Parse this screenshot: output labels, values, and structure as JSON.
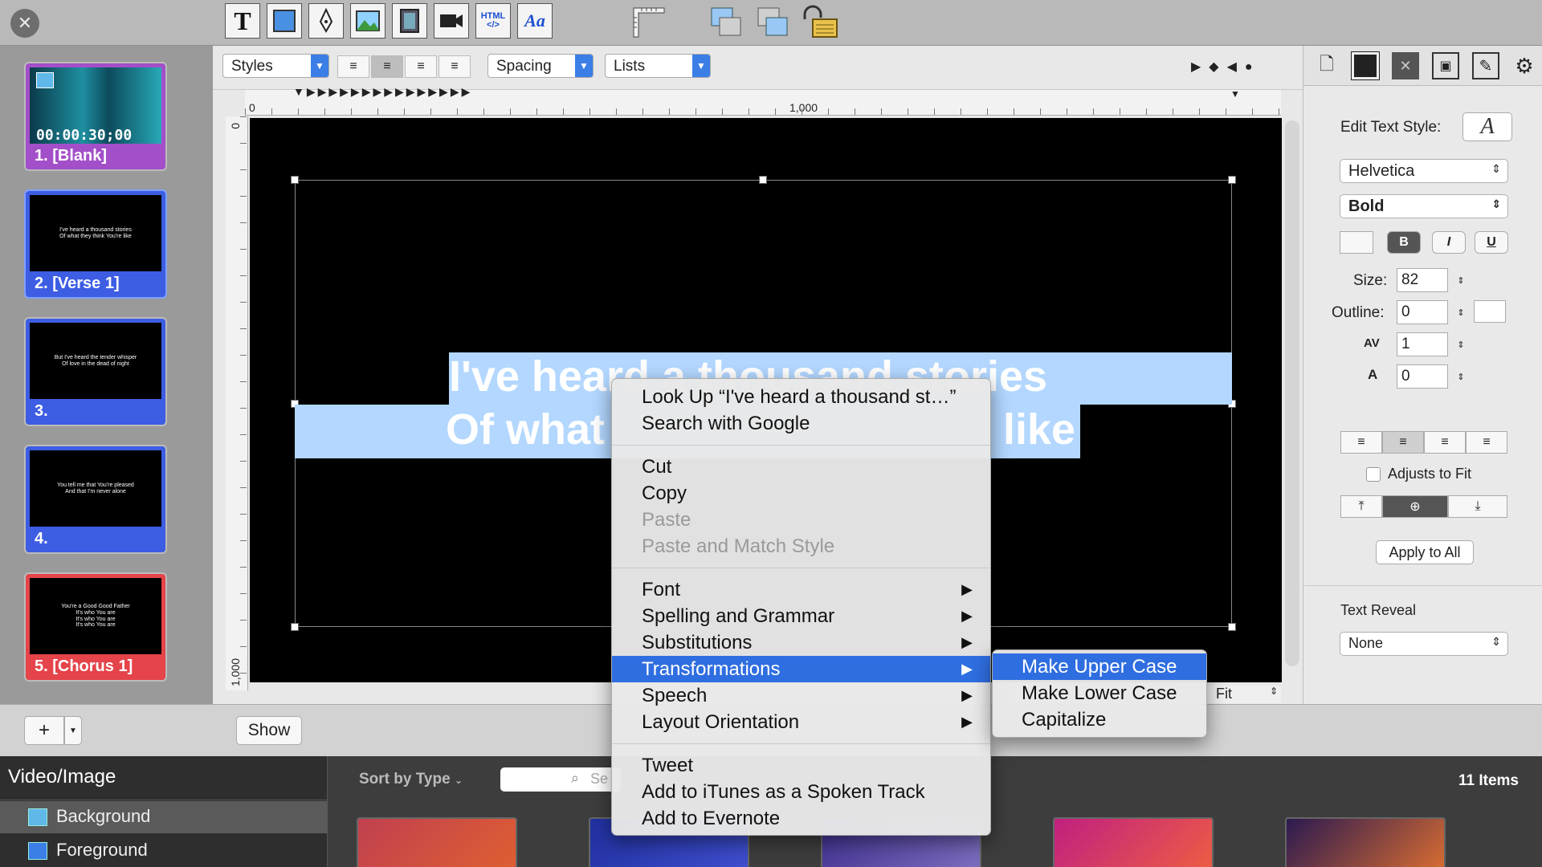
{
  "toolbar": {
    "tools": [
      "text-tool-icon",
      "shape-tool-icon",
      "pen-tool-icon",
      "image-tool-icon",
      "video-tool-icon",
      "camera-tool-icon",
      "html-tool-icon",
      "textstyle-tool-icon"
    ],
    "text_tool_label": "T",
    "html_label": "HTML",
    "textstyle_label": "Aa"
  },
  "slides": [
    {
      "label": "1. [Blank]",
      "timecode": "00:00:30;00",
      "color": "#a34fc9",
      "text": ""
    },
    {
      "label": "2. [Verse 1]",
      "color": "#3d5de3",
      "text": "I've heard a thousand stories\nOf what they think You're like"
    },
    {
      "label": "3.",
      "color": "#3d5de3",
      "text": "But I've heard the tender whisper\nOf love in the dead of night"
    },
    {
      "label": "4.",
      "color": "#3d5de3",
      "text": "You tell me that You're pleased\nAnd that I'm never alone"
    },
    {
      "label": "5. [Chorus 1]",
      "color": "#e4444a",
      "text": "You're a Good Good Father\nIt's who You are\nIt's who You are\nIt's who You are"
    }
  ],
  "editor": {
    "styles_label": "Styles",
    "spacing_label": "Spacing",
    "lists_label": "Lists",
    "ruler_h": [
      "0",
      "1,000"
    ],
    "ruler_v": [
      "0",
      "1,000"
    ],
    "line1": "I've heard a thousand stories",
    "line2": "Of what",
    "line2_end": "like",
    "fit_label": "Fit"
  },
  "inspector": {
    "edit_text_style": "Edit Text Style:",
    "font": "Helvetica",
    "weight": "Bold",
    "size_label": "Size:",
    "size": "82",
    "outline_label": "Outline:",
    "outline": "0",
    "kerning_label": "AV",
    "kerning": "1",
    "leading_label": "A",
    "leading": "0",
    "adjusts_to_fit": "Adjusts to Fit",
    "apply_all": "Apply to All",
    "text_reveal_label": "Text Reveal",
    "text_reveal": "None"
  },
  "bottom": {
    "show_label": "Show",
    "add_label": "+",
    "bin_title": "Video/Image",
    "sort_label": "Sort by Type",
    "search_placeholder": "Se",
    "items_count": "11 Items",
    "categories": [
      "Background",
      "Foreground"
    ]
  },
  "context_menu": {
    "group1": [
      "Look Up “I've heard a thousand st…”",
      "Search with Google"
    ],
    "group2": [
      "Cut",
      "Copy",
      "Paste",
      "Paste and Match Style"
    ],
    "group3": [
      "Font",
      "Spelling and Grammar",
      "Substitutions",
      "Transformations",
      "Speech",
      "Layout Orientation"
    ],
    "group4": [
      "Tweet",
      "Add to iTunes as a Spoken Track",
      "Add to Evernote"
    ],
    "submenu": [
      "Make Upper Case",
      "Make Lower Case",
      "Capitalize"
    ]
  },
  "colors": {
    "accent": "#2f6ee0",
    "selection": "#b3d7ff"
  }
}
